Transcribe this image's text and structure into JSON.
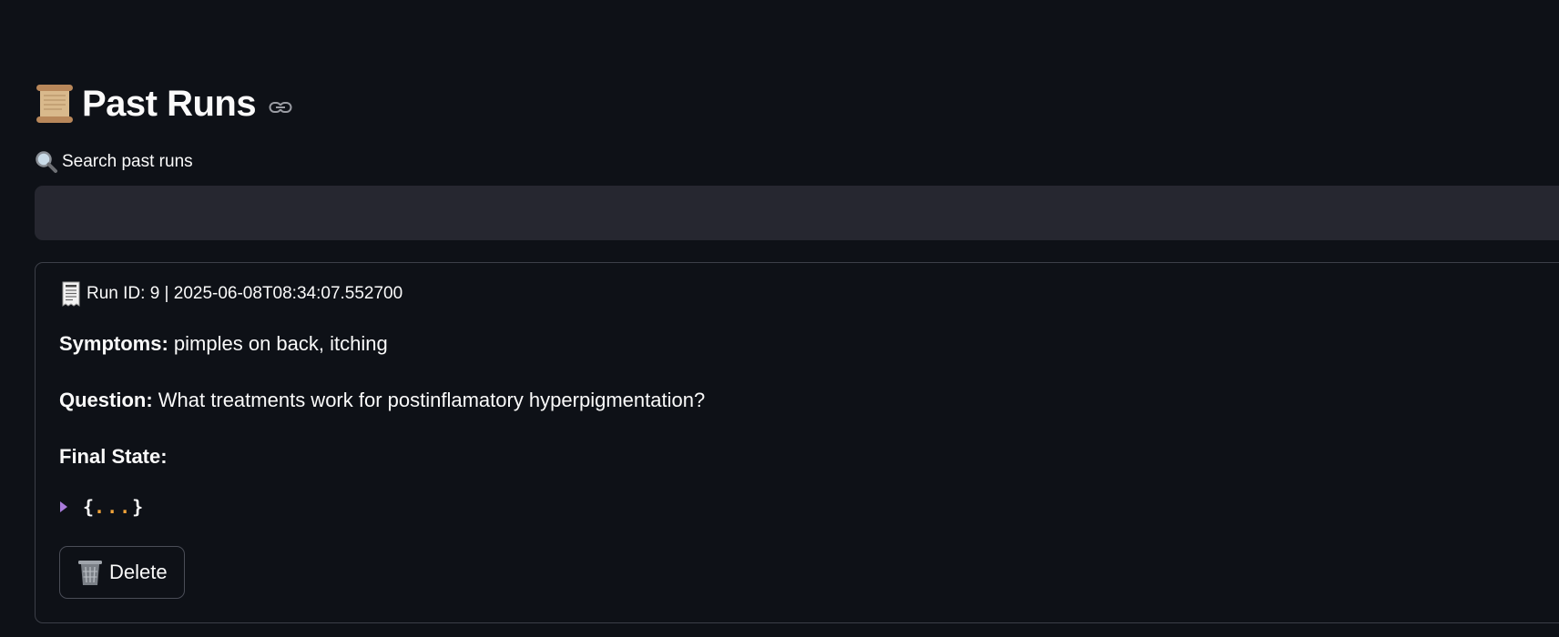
{
  "page": {
    "title": "Past Runs",
    "title_icon": "scroll-icon",
    "anchor_icon": "link-icon"
  },
  "search": {
    "label": "Search past runs",
    "icon": "magnifier-icon",
    "value": "",
    "placeholder": ""
  },
  "run": {
    "header": "Run ID: 9 | 2025-06-08T08:34:07.552700",
    "header_icon": "receipt-icon",
    "symptoms_label": "Symptoms:",
    "symptoms_value": "pimples on back, itching",
    "question_label": "Question:",
    "question_value": "What treatments work for postinflamatory hyperpigmentation?",
    "final_state_label": "Final State:",
    "json_open": "{",
    "json_dots": "...",
    "json_close": "}",
    "delete_label": "Delete",
    "delete_icon": "trash-icon"
  },
  "colors": {
    "background": "#0e1117",
    "input_background": "#262730",
    "json_dots": "#f0a33a",
    "caret": "#a97bdb"
  }
}
